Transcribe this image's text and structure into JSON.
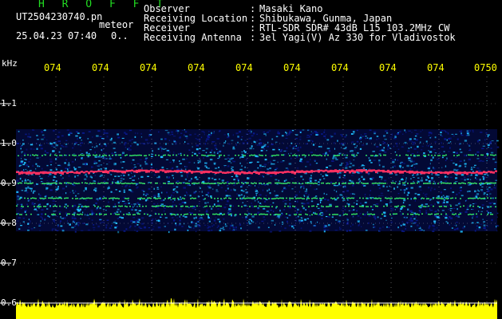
{
  "header": {
    "title": "H R O F F T",
    "file_name": "UT2504230740.pn",
    "mode": "meteor",
    "datetime": "25.04.23 07:40",
    "counter": "0.."
  },
  "info": [
    {
      "label": "Observer",
      "sep": ":",
      "value": "Masaki Kano"
    },
    {
      "label": "Receiving Location",
      "sep": ":",
      "value": "Shibukawa, Gunma, Japan"
    },
    {
      "label": "Receiver",
      "sep": ":",
      "value": "RTL-SDR SDR# 43dB L15 103.2MHz CW"
    },
    {
      "label": "Receiving Antenna",
      "sep": ":",
      "value": "3el Yagi(V) Az 330 for Vladivostok"
    }
  ],
  "axis": {
    "unit": "kHz",
    "y_ticks": [
      "1.1",
      "1.0",
      "0.9",
      "0.8",
      "0.7",
      "0.6"
    ],
    "x_ticks": [
      "074",
      "074",
      "074",
      "074",
      "074",
      "074",
      "074",
      "074",
      "074",
      "0750"
    ]
  },
  "colors": {
    "background": "#000000",
    "grid": "#ffffff",
    "time_labels": "#ffff00",
    "title": "#22dd22",
    "echo_line": "#ff3060",
    "noise_low": "#0a1a90",
    "noise_high": "#20c0ff",
    "signal_level": "#ffff00"
  }
}
